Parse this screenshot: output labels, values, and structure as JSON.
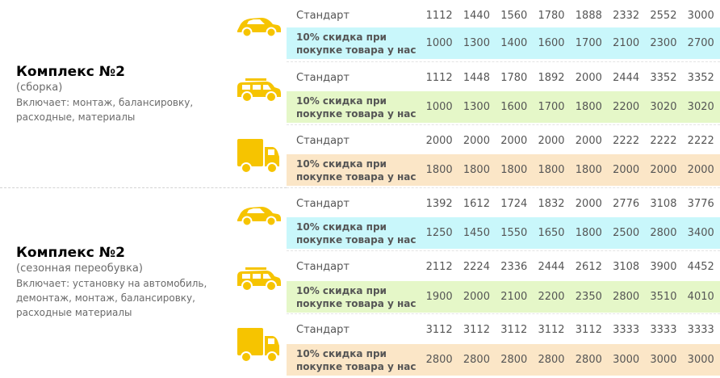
{
  "labels": {
    "standard": "Стандарт",
    "discount": "10% скидка при\nпокупке товара у нас"
  },
  "colors": {
    "icon": "#f6c400",
    "discount_car": "#c9f7fb",
    "discount_suv": "#e5f7c8",
    "discount_truck": "#fbe6c7"
  },
  "complexes": [
    {
      "title": "Комплекс №2",
      "subtitle": "(сборка)",
      "includes": "Включает: монтаж, балансировку,\nрасходные, материалы",
      "vehicles": [
        {
          "icon": "car-icon",
          "standard": [
            "1112",
            "1440",
            "1560",
            "1780",
            "1888",
            "2332",
            "2552",
            "3000"
          ],
          "discount": [
            "1000",
            "1300",
            "1400",
            "1600",
            "1700",
            "2100",
            "2300",
            "2700"
          ]
        },
        {
          "icon": "suv-icon",
          "standard": [
            "1112",
            "1448",
            "1780",
            "1892",
            "2000",
            "2444",
            "3352",
            "3352"
          ],
          "discount": [
            "1000",
            "1300",
            "1600",
            "1700",
            "1800",
            "2200",
            "3020",
            "3020"
          ]
        },
        {
          "icon": "truck-icon",
          "standard": [
            "2000",
            "2000",
            "2000",
            "2000",
            "2000",
            "2222",
            "2222",
            "2222"
          ],
          "discount": [
            "1800",
            "1800",
            "1800",
            "1800",
            "1800",
            "2000",
            "2000",
            "2000"
          ]
        }
      ]
    },
    {
      "title": "Комплекс №2",
      "subtitle": "(сезонная переобувка)",
      "includes": "Включает: установку на автомобиль,\nдемонтаж, монтаж, балансировку,\nрасходные материалы",
      "vehicles": [
        {
          "icon": "car-icon",
          "standard": [
            "1392",
            "1612",
            "1724",
            "1832",
            "2000",
            "2776",
            "3108",
            "3776"
          ],
          "discount": [
            "1250",
            "1450",
            "1550",
            "1650",
            "1800",
            "2500",
            "2800",
            "3400"
          ]
        },
        {
          "icon": "suv-icon",
          "standard": [
            "2112",
            "2224",
            "2336",
            "2444",
            "2612",
            "3108",
            "3900",
            "4452"
          ],
          "discount": [
            "1900",
            "2000",
            "2100",
            "2200",
            "2350",
            "2800",
            "3510",
            "4010"
          ]
        },
        {
          "icon": "truck-icon",
          "standard": [
            "3112",
            "3112",
            "3112",
            "3112",
            "3112",
            "3333",
            "3333",
            "3333"
          ],
          "discount": [
            "2800",
            "2800",
            "2800",
            "2800",
            "2800",
            "3000",
            "3000",
            "3000"
          ]
        }
      ]
    }
  ]
}
